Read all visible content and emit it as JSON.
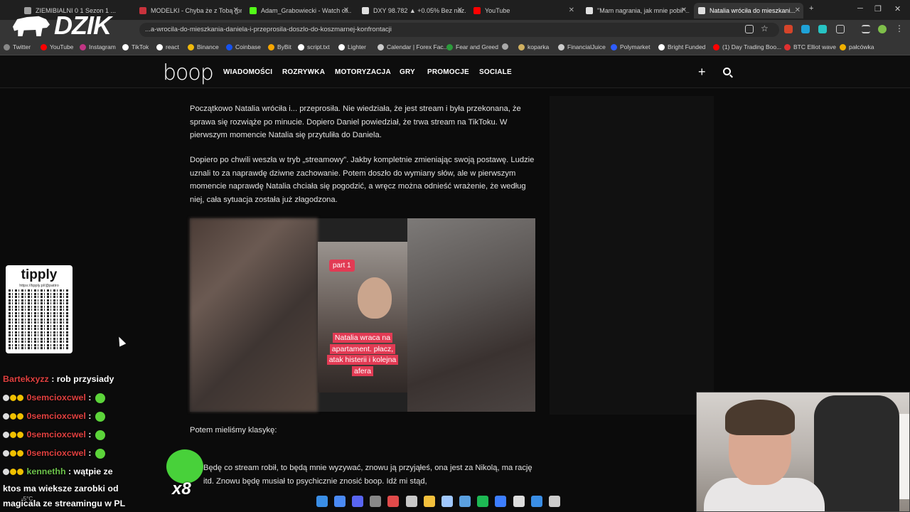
{
  "tabs": [
    {
      "title": "ZIEMIBIALNI 0 1 Sezon 1 ...",
      "color": "#a0a0a0"
    },
    {
      "title": "MODELKI - Chyba że z Tobą (pro...",
      "color": "#c8323c"
    },
    {
      "title": "Adam_Grabowiecki - Watch cli...",
      "color": "#53fc18"
    },
    {
      "title": "DXY 98.782 ▲ +0.05% Bez naz...",
      "color": "#e0e0e0"
    },
    {
      "title": "YouTube",
      "color": "#ff0000"
    },
    {
      "title": "\"Mam nagrania, jak mnie pobił\"...",
      "color": "#e0e0e0"
    },
    {
      "title": "Natalia wróciła do mieszkani...",
      "color": "#e0e0e0"
    }
  ],
  "url": "wroci-wrocila-do-mieszkania-daniela-i-przeprosila-doszlo-do-koszmarnej-konfrontacji",
  "url_display": "...a-wrocila-do-mieszkania-daniela-i-przeprosila-doszlo-do-koszmarnej-konfrontacji",
  "bookmarks": [
    {
      "label": "Twitter",
      "color": "#888"
    },
    {
      "label": "YouTube",
      "color": "#ff0000"
    },
    {
      "label": "Instagram",
      "color": "#c13584"
    },
    {
      "label": "TikTok",
      "color": "#ffffff"
    },
    {
      "label": "react",
      "color": "#ffffff"
    },
    {
      "label": "Binance",
      "color": "#f0b90b"
    },
    {
      "label": "Coinbase",
      "color": "#1652f0"
    },
    {
      "label": "ByBit",
      "color": "#f7a600"
    },
    {
      "label": "script.txt",
      "color": "#ffffff"
    },
    {
      "label": "Lighter",
      "color": "#ffffff"
    },
    {
      "label": "Calendar | Forex Fac...",
      "color": "#cccccc"
    },
    {
      "label": "Fear and Greed",
      "color": "#2c9b3c"
    },
    {
      "label": "",
      "color": "#aaaaaa"
    },
    {
      "label": "koparka",
      "color": "#d0b060"
    },
    {
      "label": "FinancialJuice",
      "color": "#cccccc"
    },
    {
      "label": "Polymarket",
      "color": "#2e5cff"
    },
    {
      "label": "Bright Funded",
      "color": "#ffffff"
    },
    {
      "label": "(1) Day Trading Boo...",
      "color": "#ff0000"
    },
    {
      "label": "BTC Elliot wave",
      "color": "#e03030"
    },
    {
      "label": "pałcówka",
      "color": "#f0b000"
    }
  ],
  "overlay": {
    "brand": "DZIK"
  },
  "site": {
    "logo": "boop",
    "nav": [
      "WIADOMOŚCI",
      "ROZRYWKA",
      "MOTORYZACJA",
      "GRY",
      "PROMOCJE",
      "SOCIALE"
    ]
  },
  "article": {
    "p1": "Początkowo Natalia wróciła i... przeprosiła. Nie wiedziała, że jest stream i była przekonana, że sprawa się rozwiąże po minucie. Dopiero Daniel powiedział, że trwa stream na TikToku. W pierwszym momencie Natalia się przytuliła do Daniela.",
    "p2": "Dopiero po chwili weszła w tryb „streamowy”. Jakby kompletnie zmieniając swoją postawę. Ludzie uznali to za naprawdę dziwne zachowanie. Potem doszło do wymiany słów, ale w pierwszym momencie naprawdę Natalia chciała się pogodzić, a wręcz można odnieść wrażenie, że według niej, cała sytuacja została już złagodzona.",
    "video_badge": "part 1",
    "video_caption": "Natalia wraca na apartament. płacz, atak histerii i kolejna afera",
    "p3": "Potem mieliśmy klasykę:",
    "p4": "Będę co stream robił, to będą mnie wyzywać, znowu ją przyjąłeś, ona jest za Nikolą, ma rację itd. Znowu będę musiał to psychicznie znosić boop. Idź mi stąd,"
  },
  "tipply": {
    "title": "tipply",
    "url": "https://tipply.pl/@patiro"
  },
  "chat": [
    {
      "user": "Bartekxyzz",
      "msg": ": rob przysiady",
      "user_color": "#e0403f",
      "badges": false
    },
    {
      "user": "0semcioxcwel",
      "msg": ":",
      "user_color": "#e0403f",
      "badges": true
    },
    {
      "user": "0semcioxcwel",
      "msg": ":",
      "user_color": "#e0403f",
      "badges": true
    },
    {
      "user": "0semcioxcwel",
      "msg": ":",
      "user_color": "#e0403f",
      "badges": true
    },
    {
      "user": "0semcioxcwel",
      "msg": ":",
      "user_color": "#e0403f",
      "badges": true
    },
    {
      "user": "kennethh",
      "msg": ": wątpie ze",
      "user_color": "#6cc24a",
      "badges": true
    }
  ],
  "chat_cont": [
    "ktos ma wieksze zarobki od",
    "magicala ze streamingu w PL"
  ],
  "gift_multiplier": "x8",
  "weather": "-5°C",
  "taskbar_colors": [
    "#3a8ee6",
    "#4a8af4",
    "#5865f2",
    "#888888",
    "#e04a4a",
    "#c8c8c8",
    "#f3c03c",
    "#a0c8ff",
    "#5aa0e0",
    "#1db954",
    "#3d7eff",
    "#dddddd",
    "#3a8ee6",
    "#cccccc"
  ]
}
